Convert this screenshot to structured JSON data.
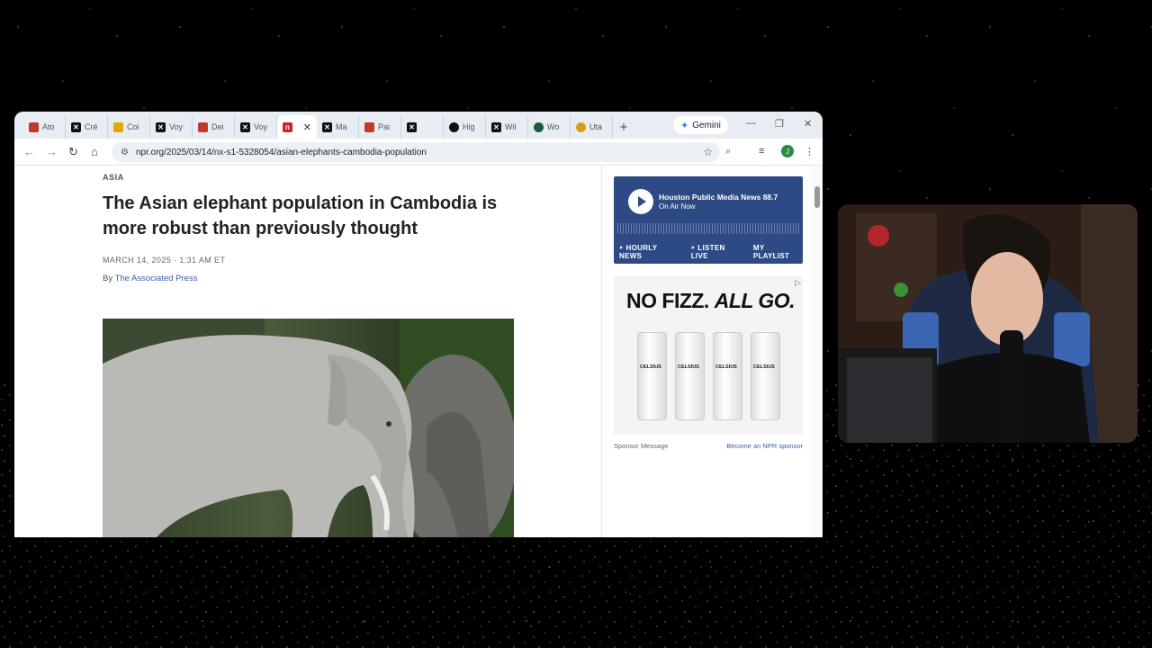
{
  "tabs": [
    {
      "label": "Ato",
      "favicon": "doc-icon",
      "color": "#c0392b"
    },
    {
      "label": "Cré",
      "favicon": "x-icon",
      "color": "#111111"
    },
    {
      "label": "Coi",
      "favicon": "doc-icon",
      "color": "#e0a800"
    },
    {
      "label": "Voy",
      "favicon": "x-icon",
      "color": "#111111"
    },
    {
      "label": "Dei",
      "favicon": "doc-icon",
      "color": "#c0392b"
    },
    {
      "label": "Voy",
      "favicon": "x-icon",
      "color": "#111111"
    },
    {
      "label": "",
      "favicon": "npr-icon",
      "color": "#d62021",
      "active": true
    },
    {
      "label": "Ma",
      "favicon": "x-icon",
      "color": "#111111"
    },
    {
      "label": "Pai",
      "favicon": "doc-icon",
      "color": "#c0392b"
    },
    {
      "label": "",
      "favicon": "x-icon",
      "color": "#111111"
    },
    {
      "label": "Hig",
      "favicon": "circle-icon",
      "color": "#111111"
    },
    {
      "label": "Wil",
      "favicon": "x-icon",
      "color": "#111111"
    },
    {
      "label": "Wo",
      "favicon": "circle-icon",
      "color": "#1a5c3a"
    },
    {
      "label": "Uta",
      "favicon": "circle-icon",
      "color": "#d4a017"
    }
  ],
  "gemini_label": "Gemini",
  "url": "npr.org/2025/03/14/nx-s1-5328054/asian-elephants-cambodia-population",
  "article": {
    "section": "ASIA",
    "headline": "The Asian elephant population in Cambodia is more robust than previously thought",
    "dateline": "MARCH 14, 2025 · 1:31 AM ET",
    "byline_prefix": "By ",
    "byline_author": "The Associated Press"
  },
  "player": {
    "station": "Houston Public Media News 88.7",
    "status": "On Air Now",
    "links": [
      "‣ HOURLY NEWS",
      "‣ LISTEN LIVE",
      "MY PLAYLIST"
    ]
  },
  "ad": {
    "slogan_part1": "NO FIZZ. ",
    "slogan_part2": "ALL GO.",
    "can_label": "CELSIUS",
    "sponsor_message": "Sponsor Message",
    "become_sponsor": "Become an NPR sponsor"
  },
  "colors": {
    "npr_blue": "#2e4a85",
    "link": "#3a5fa8"
  }
}
